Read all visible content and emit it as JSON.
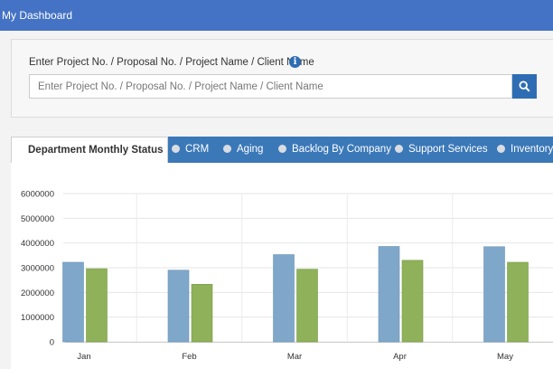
{
  "header": {
    "title": "My Dashboard"
  },
  "search": {
    "label": "Enter Project No. / Proposal No. / Project Name / Client Name",
    "placeholder": "Enter Project No. / Proposal No. / Project Name / Client Name",
    "info_icon": "info-icon",
    "button_icon": "search-icon"
  },
  "tabs": [
    {
      "label": "Department Monthly Status",
      "active": true
    },
    {
      "label": "CRM"
    },
    {
      "label": "Aging"
    },
    {
      "label": "Backlog By Company"
    },
    {
      "label": "Support Services"
    },
    {
      "label": "Inventory"
    }
  ],
  "colors": {
    "topbar": "#4472c4",
    "tabbar": "#3b78b8",
    "series1": "#7fa7c9",
    "series2": "#8fb15a"
  },
  "chart_data": {
    "type": "bar",
    "categories": [
      "Jan",
      "Feb",
      "Mar",
      "Apr",
      "May"
    ],
    "series": [
      {
        "values": [
          3220000,
          2900000,
          3530000,
          3860000,
          3850000
        ]
      },
      {
        "values": [
          2960000,
          2330000,
          2940000,
          3300000,
          3220000
        ]
      }
    ],
    "ylim": [
      0,
      6000000
    ],
    "yticks": [
      "6000000",
      "5000000",
      "4000000",
      "3000000",
      "2000000",
      "1000000",
      "0"
    ],
    "grid": true
  }
}
